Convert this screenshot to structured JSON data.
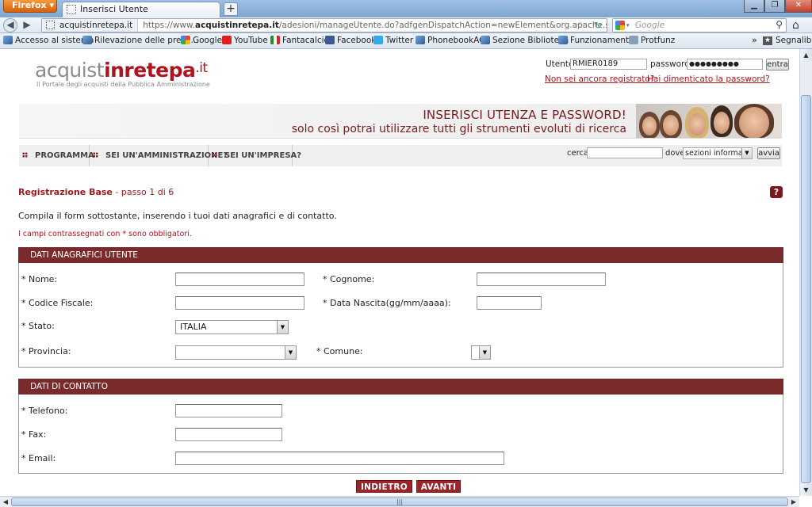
{
  "browser": {
    "menu_button": "Firefox",
    "tab_title": "Inserisci Utente",
    "new_tab": "+",
    "url_site": "acquistinretepa.it",
    "url_prefix": "https://www.",
    "url_domain": "acquistinretepa.it",
    "url_path": "/adesioni/manageUtente.do?adfgenDispatchAction=newElement&org.apache.struts.taglib.html.CANC",
    "search_placeholder": "Google",
    "bookmarks": [
      {
        "label": "Accesso al sistema",
        "icon": "page-icon"
      },
      {
        "label": "Rilevazione delle prese...",
        "icon": "page-icon"
      },
      {
        "label": "Google",
        "icon": "google-icon"
      },
      {
        "label": "YouTube",
        "icon": "youtube-icon"
      },
      {
        "label": "Fantacalcio",
        "icon": "fantacalcio-icon"
      },
      {
        "label": "Facebook",
        "icon": "facebook-icon"
      },
      {
        "label": "Twitter",
        "icon": "twitter-icon"
      },
      {
        "label": "PhonebookAC",
        "icon": "page-icon"
      },
      {
        "label": "Sezione Biblioteca",
        "icon": "page-icon"
      },
      {
        "label": "Funzionamento",
        "icon": "page-icon"
      },
      {
        "label": "Protfunz",
        "icon": "page-icon"
      }
    ],
    "bookmarks_more": "»",
    "bookmarks_folder": "Segnalibri"
  },
  "header": {
    "logo_part1": "acquist",
    "logo_part2": "inrete",
    "logo_part3": "pa",
    "logo_part4": ".it",
    "logo_subtitle": "Il Portale degli acquisti della Pubblica Amministrazione",
    "login": {
      "user_label": "Utente",
      "user_value": "RMIER0189",
      "password_label": "password",
      "password_value": "●●●●●●●●●",
      "submit": "entra",
      "register_link": "Non sei ancora registrato?",
      "forgot_link": "Hai dimenticato la password?"
    }
  },
  "banner": {
    "line1": "INSERISCI UTENZA E PASSWORD!",
    "line2": "solo così potrai utilizzare tutti gli strumenti evoluti di ricerca"
  },
  "nav": {
    "items": [
      "PROGRAMMA",
      "SEI UN'AMMINISTRAZIONE?",
      "SEI UN'IMPRESA?"
    ],
    "search_label": "cerca",
    "where_label": "dove",
    "where_selected": "sezioni informative",
    "search_button": "avvia"
  },
  "form": {
    "title_bold": "Registrazione Base",
    "title_step": " - passo 1 di 6",
    "help": "?",
    "instructions": "Compila il form sottostante, inserendo i tuoi dati anagrafici e di contatto.",
    "required_note": "I campi contrassegnati con * sono obbligatori.",
    "section1_title": "DATI ANAGRAFICI UTENTE",
    "nome_label": "* Nome:",
    "cognome_label": "* Cognome:",
    "cf_label": "* Codice Fiscale:",
    "nascita_label": "* Data Nascita(gg/mm/aaaa):",
    "stato_label": "* Stato:",
    "stato_value": "ITALIA",
    "provincia_label": "* Provincia:",
    "provincia_value": "",
    "comune_label": "* Comune:",
    "comune_value": "",
    "section2_title": "DATI DI CONTATTO",
    "telefono_label": "* Telefono:",
    "fax_label": "* Fax:",
    "email_label": "* Email:",
    "back_button": "INDIETRO",
    "next_button": "AVANTI"
  }
}
